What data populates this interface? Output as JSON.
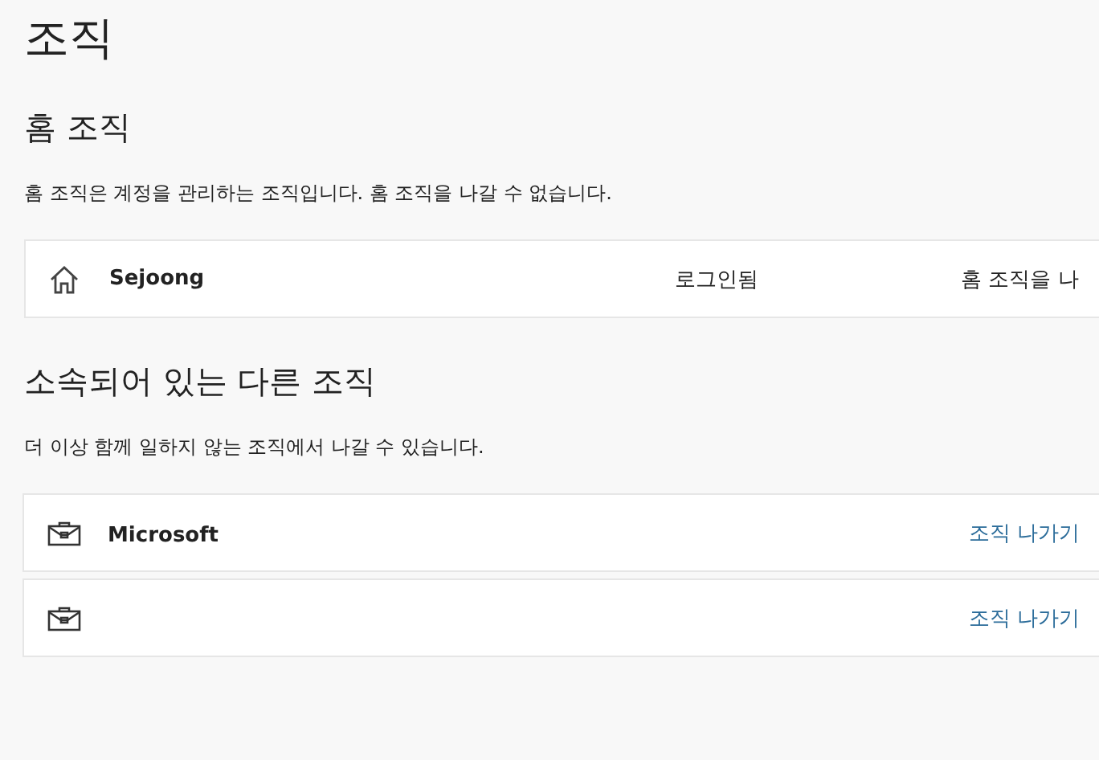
{
  "title": "조직",
  "home": {
    "heading": "홈 조직",
    "description": "홈 조직은 계정을 관리하는 조직입니다. 홈 조직을 나갈 수 없습니다.",
    "org": {
      "name": "Sejoong",
      "status": "로그인됨",
      "action": "홈 조직을 나"
    }
  },
  "other": {
    "heading": "소속되어 있는 다른 조직",
    "description": "더 이상 함께 일하지 않는 조직에서 나갈 수 있습니다.",
    "orgs": [
      {
        "name": "Microsoft",
        "action": "조직 나가기"
      },
      {
        "action": "조직 나가기"
      }
    ]
  }
}
